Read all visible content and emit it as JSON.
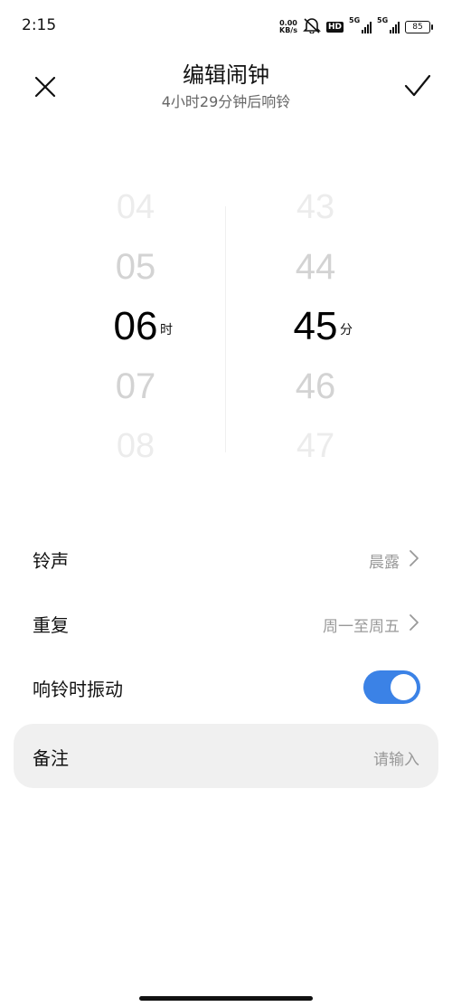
{
  "status_bar": {
    "time": "2:15",
    "net_speed_value": "0.00",
    "net_speed_unit": "KB/s",
    "hd_label": "HD",
    "signal1_label": "5G",
    "signal2_label": "5G",
    "battery": "85"
  },
  "header": {
    "title": "编辑闹钟",
    "subtitle": "4小时29分钟后响铃"
  },
  "picker": {
    "hours": [
      "04",
      "05",
      "06",
      "07",
      "08"
    ],
    "minutes": [
      "43",
      "44",
      "45",
      "46",
      "47"
    ],
    "hour_unit": "时",
    "minute_unit": "分",
    "selected_hour": "06",
    "selected_minute": "45"
  },
  "settings": {
    "ringtone_label": "铃声",
    "ringtone_value": "晨露",
    "repeat_label": "重复",
    "repeat_value": "周一至周五",
    "vibrate_label": "响铃时振动",
    "vibrate_on": true,
    "note_label": "备注",
    "note_placeholder": "请输入"
  },
  "colors": {
    "accent": "#3b82e6",
    "card_bg": "#f0f0f0"
  }
}
